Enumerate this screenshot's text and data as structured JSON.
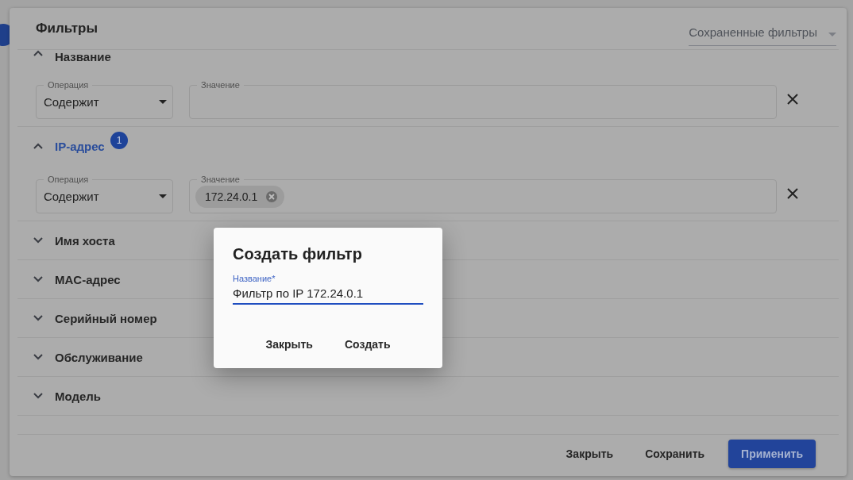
{
  "panel": {
    "title": "Фильтры",
    "saved_filters": {
      "placeholder": "Сохраненные фильтры"
    }
  },
  "sections": [
    {
      "label": "Название",
      "expanded": true,
      "operation": {
        "label": "Операция",
        "value": "Содержит"
      },
      "value_field": {
        "label": "Значение"
      }
    },
    {
      "label": "IP-адрес",
      "expanded": true,
      "badge": "1",
      "operation": {
        "label": "Операция",
        "value": "Содержит"
      },
      "value_field": {
        "label": "Значение",
        "chips": [
          {
            "text": "172.24.0.1"
          }
        ]
      }
    },
    {
      "label": "Имя хоста",
      "expanded": false
    },
    {
      "label": "MAC-адрес",
      "expanded": false
    },
    {
      "label": "Серийный номер",
      "expanded": false
    },
    {
      "label": "Обслуживание",
      "expanded": false
    },
    {
      "label": "Модель",
      "expanded": false
    }
  ],
  "footer_buttons": [
    {
      "label": "Закрыть",
      "kind": "text"
    },
    {
      "label": "Сохранить",
      "kind": "text"
    },
    {
      "label": "Применить",
      "kind": "primary"
    }
  ],
  "dialog": {
    "title": "Создать фильтр",
    "field": {
      "label": "Название*",
      "value": "Фильтр по IP 172.24.0.1",
      "focused": true
    },
    "buttons": [
      {
        "label": "Закрыть"
      },
      {
        "label": "Создать"
      }
    ]
  }
}
